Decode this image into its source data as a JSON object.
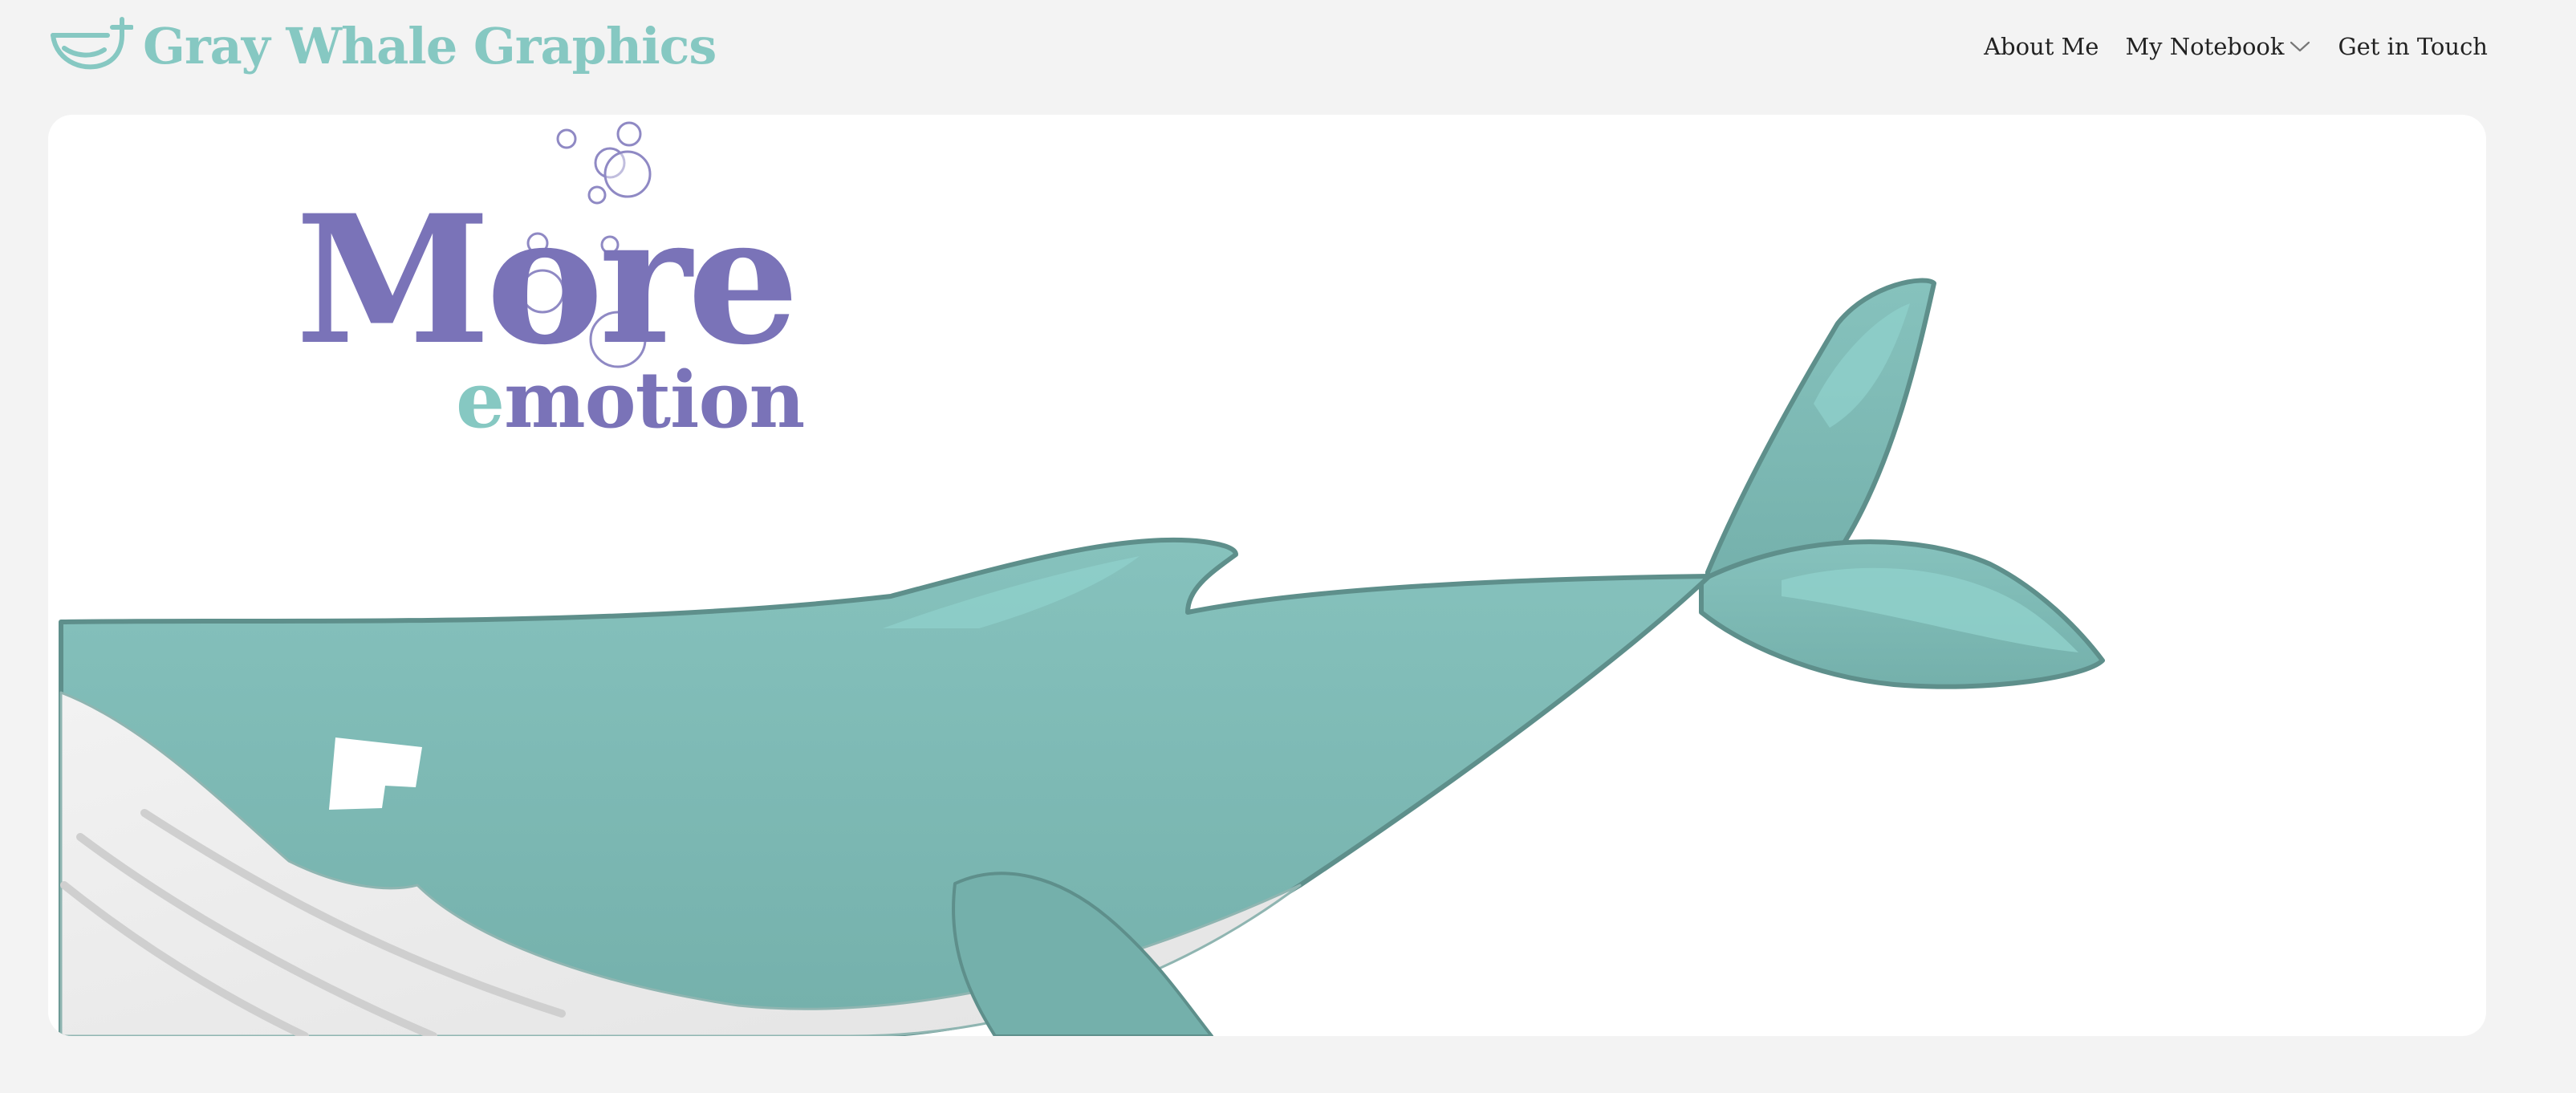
{
  "brand": {
    "title": "Gray Whale Graphics",
    "logo_icon": "whale-tail-logo-icon",
    "color": "#86c8c2"
  },
  "nav": {
    "items": [
      {
        "label": "About Me",
        "has_dropdown": false
      },
      {
        "label": "My Notebook",
        "has_dropdown": true,
        "dropdown_icon": "chevron-down-icon"
      },
      {
        "label": "Get in Touch",
        "has_dropdown": false
      }
    ]
  },
  "hero": {
    "headline_word": "More",
    "subline_first_letter": "e",
    "subline_rest": "motion",
    "headline_color": "#7a73b8",
    "accent_color": "#86c8c2",
    "illustration": "humpback-whale-illustration",
    "decoration": "bubbles-icon"
  },
  "colors": {
    "page_background": "#f3f3f3",
    "card_background": "#ffffff",
    "whale_body": "#7fbcb7",
    "whale_outline": "#5e8f8b",
    "whale_belly": "#ececec"
  }
}
